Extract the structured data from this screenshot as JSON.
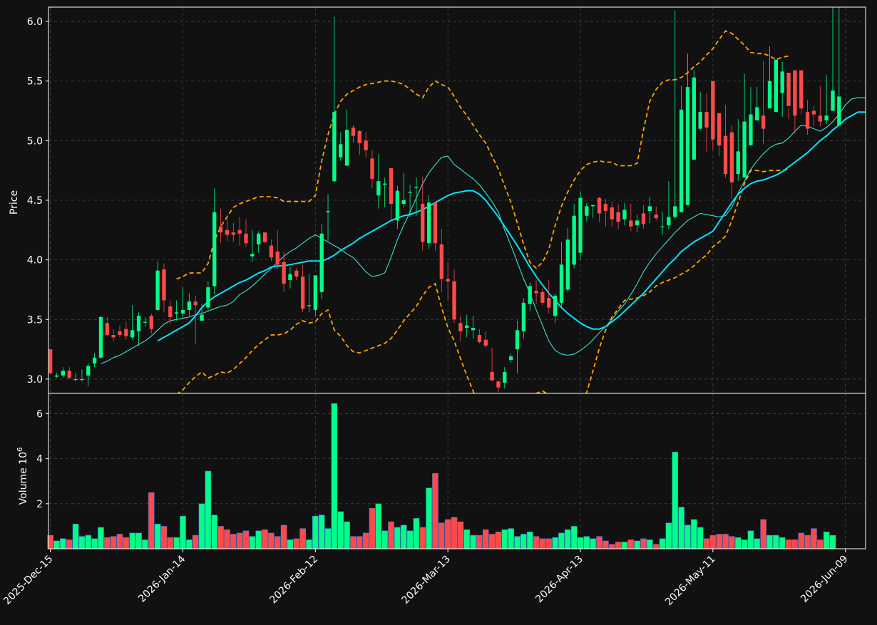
{
  "chart_data": {
    "type": "candlestick",
    "price_panel": {
      "ylabel": "Price",
      "ylim": [
        2.88,
        6.12
      ],
      "yticks": [
        "3.0",
        "3.5",
        "4.0",
        "4.5",
        "5.0",
        "5.5",
        "6.0"
      ],
      "grid": true
    },
    "volume_panel": {
      "ylabel": "Volume  10",
      "ylabel_exponent": "6",
      "ylim": [
        0,
        6.9
      ],
      "yticks": [
        "2",
        "4",
        "6"
      ],
      "grid": true
    },
    "x_tick_labels": [
      {
        "label": "2025-Dec-15",
        "index": 0
      },
      {
        "label": "2026-Jan-14",
        "index": 21
      },
      {
        "label": "2026-Feb-12",
        "index": 42
      },
      {
        "label": "2026-Mar-13",
        "index": 63
      },
      {
        "label": "2026-Apr-13",
        "index": 84
      },
      {
        "label": "2026-May-11",
        "index": 105
      },
      {
        "label": "2026-Jun-09",
        "index": 126
      }
    ],
    "x_range": [
      -0.3,
      129.2
    ],
    "colors": {
      "background": "#111111",
      "up": "#00ff88",
      "down": "#ff4a4a",
      "ma_short": "#40e0d0",
      "ma_long": "#00e5ff",
      "bands": "#ffa500",
      "grid": "#444444"
    },
    "series": [
      {
        "name": "candles",
        "open": [
          3.25,
          3.02,
          3.03,
          3.07,
          3.0,
          3.0,
          3.03,
          3.13,
          3.18,
          3.47,
          3.37,
          3.4,
          3.42,
          3.35,
          3.4,
          3.48,
          3.53,
          3.58,
          3.92,
          3.61,
          3.55,
          3.55,
          3.58,
          3.65,
          3.49,
          3.6,
          3.78,
          4.28,
          4.25,
          4.23,
          4.25,
          4.22,
          4.03,
          4.13,
          4.23,
          4.12,
          4.07,
          3.98,
          3.83,
          3.91,
          3.86,
          3.62,
          3.58,
          3.73,
          4.4,
          4.66,
          4.86,
          4.79,
          5.11,
          5.08,
          5.0,
          4.85,
          4.54,
          4.63,
          4.77,
          4.33,
          4.47,
          4.57,
          4.61,
          4.47,
          4.14,
          4.48,
          4.13,
          3.84,
          3.82,
          3.47,
          3.43,
          3.41,
          3.37,
          3.33,
          3.06,
          2.98,
          2.97,
          3.16,
          3.25,
          3.4,
          3.63,
          3.74,
          3.73,
          3.68,
          3.53,
          3.64,
          3.75,
          3.96,
          4.06,
          4.37,
          4.45,
          4.52,
          4.47,
          4.44,
          4.4,
          4.34,
          4.33,
          4.29,
          4.39,
          4.41,
          4.38,
          4.28,
          4.29,
          4.36,
          4.4,
          4.46,
          4.84,
          5.1,
          5.24,
          5.5,
          5.23,
          5.04,
          5.07,
          4.72,
          4.69,
          4.96,
          5.17,
          5.21,
          5.27,
          5.24,
          5.4,
          5.57,
          5.59,
          5.59,
          5.24,
          5.25,
          5.21,
          5.17,
          5.25,
          5.13,
          5.19,
          5.42
        ],
        "close": [
          3.05,
          3.03,
          3.07,
          3.01,
          3.0,
          3.0,
          3.11,
          3.18,
          3.52,
          3.37,
          3.35,
          3.37,
          3.36,
          3.41,
          3.53,
          3.48,
          3.42,
          3.91,
          3.66,
          3.52,
          3.56,
          3.58,
          3.65,
          3.62,
          3.54,
          3.77,
          4.4,
          4.23,
          4.21,
          4.21,
          4.22,
          4.14,
          4.05,
          4.22,
          4.15,
          4.02,
          3.96,
          3.8,
          3.88,
          3.86,
          3.59,
          3.62,
          3.87,
          4.22,
          4.41,
          5.24,
          4.97,
          5.09,
          5.04,
          4.98,
          4.92,
          4.68,
          4.66,
          4.64,
          4.47,
          4.58,
          4.5,
          4.57,
          4.61,
          4.15,
          4.48,
          4.14,
          3.84,
          3.82,
          3.5,
          3.4,
          3.45,
          3.43,
          3.31,
          3.28,
          2.99,
          2.93,
          3.06,
          3.19,
          3.41,
          3.64,
          3.78,
          3.72,
          3.64,
          3.6,
          3.7,
          3.96,
          4.17,
          4.37,
          4.52,
          4.45,
          4.46,
          4.39,
          4.41,
          4.34,
          4.32,
          4.42,
          4.28,
          4.33,
          4.3,
          4.45,
          4.35,
          4.28,
          4.36,
          4.45,
          5.26,
          5.45,
          5.53,
          5.24,
          5.11,
          5.01,
          4.96,
          4.72,
          4.65,
          4.91,
          5.16,
          5.22,
          5.28,
          5.1,
          5.5,
          5.68,
          5.58,
          5.29,
          5.21,
          5.27,
          5.1,
          5.22,
          5.16,
          5.21,
          5.42,
          5.37
        ],
        "high": [
          3.25,
          3.05,
          3.1,
          3.1,
          3.05,
          3.08,
          3.13,
          3.22,
          3.53,
          3.52,
          3.42,
          3.45,
          3.48,
          3.62,
          3.56,
          3.52,
          3.55,
          3.99,
          3.97,
          3.66,
          3.66,
          3.77,
          3.72,
          3.7,
          3.63,
          3.82,
          4.6,
          4.43,
          4.38,
          4.31,
          4.36,
          4.34,
          4.25,
          4.24,
          4.22,
          4.17,
          4.25,
          4.07,
          3.94,
          3.93,
          3.96,
          3.88,
          3.7,
          4.3,
          4.55,
          6.04,
          5.07,
          5.26,
          5.13,
          5.09,
          5.07,
          4.92,
          4.89,
          4.69,
          4.77,
          4.62,
          4.73,
          4.63,
          4.69,
          4.7,
          4.54,
          4.48,
          4.26,
          3.98,
          3.92,
          3.53,
          3.54,
          3.53,
          3.42,
          3.4,
          3.26,
          2.99,
          3.1,
          3.21,
          3.49,
          3.68,
          3.81,
          3.83,
          3.76,
          3.83,
          3.72,
          4.15,
          4.27,
          4.47,
          4.57,
          4.48,
          4.46,
          4.53,
          4.51,
          4.49,
          4.47,
          4.48,
          4.47,
          4.38,
          4.46,
          4.53,
          4.45,
          4.4,
          4.66,
          6.09,
          5.46,
          5.73,
          5.59,
          5.41,
          5.4,
          5.21,
          5.19,
          5.3,
          5.13,
          5.18,
          5.56,
          5.45,
          5.45,
          5.67,
          5.79,
          5.63,
          5.66,
          5.27,
          5.34,
          5.29,
          5.34,
          5.29,
          5.46,
          5.55
        ],
        "low": [
          3.04,
          3.01,
          3.01,
          3.0,
          2.98,
          2.98,
          2.94,
          3.1,
          3.17,
          3.36,
          3.32,
          3.35,
          3.33,
          3.33,
          3.28,
          3.44,
          3.38,
          3.57,
          3.56,
          3.46,
          3.49,
          3.51,
          3.53,
          3.29,
          3.49,
          3.57,
          3.71,
          4.14,
          4.16,
          4.15,
          4.12,
          4.11,
          3.98,
          4.06,
          4.14,
          3.99,
          3.92,
          3.73,
          3.76,
          3.83,
          3.56,
          3.56,
          3.53,
          3.67,
          4.16,
          4.65,
          4.83,
          4.8,
          4.98,
          4.88,
          4.86,
          4.6,
          4.43,
          4.44,
          4.33,
          4.26,
          4.44,
          4.36,
          4.37,
          4.08,
          4.09,
          4.08,
          3.73,
          3.66,
          3.47,
          3.31,
          3.35,
          3.34,
          3.3,
          3.26,
          2.98,
          2.89,
          2.92,
          3.14,
          3.05,
          3.34,
          3.57,
          3.63,
          3.62,
          3.55,
          3.47,
          3.6,
          3.73,
          3.93,
          4.0,
          4.32,
          4.35,
          4.32,
          4.28,
          4.28,
          4.26,
          4.29,
          4.24,
          4.23,
          4.26,
          4.31,
          4.33,
          4.21,
          4.26,
          4.34,
          4.83,
          5.0,
          5.09,
          5.08,
          4.91,
          4.92,
          4.87,
          4.69,
          4.51,
          4.66,
          4.9,
          5.14,
          5.19,
          4.97,
          5.3,
          5.48,
          5.2,
          5.18,
          5.06,
          5.22,
          5.05,
          5.12,
          5.12,
          5.14,
          5.31,
          5.22
        ]
      },
      {
        "name": "volume",
        "values": [
          0.6,
          0.35,
          0.45,
          0.4,
          1.1,
          0.55,
          0.6,
          0.45,
          0.95,
          0.5,
          0.55,
          0.65,
          0.5,
          0.7,
          0.7,
          0.4,
          2.5,
          1.1,
          1.0,
          0.5,
          0.5,
          1.45,
          0.4,
          0.6,
          2.0,
          3.45,
          1.5,
          1.0,
          0.85,
          0.65,
          0.7,
          0.8,
          0.55,
          0.8,
          0.85,
          0.7,
          0.55,
          1.05,
          0.4,
          0.45,
          0.9,
          0.4,
          1.45,
          1.5,
          0.9,
          6.45,
          1.65,
          1.2,
          0.55,
          0.55,
          0.7,
          1.8,
          2.0,
          0.8,
          1.2,
          0.95,
          1.05,
          0.8,
          1.35,
          0.95,
          2.7,
          3.35,
          1.15,
          1.3,
          1.4,
          1.2,
          0.85,
          0.6,
          0.6,
          0.85,
          0.65,
          0.75,
          0.85,
          0.9,
          0.55,
          0.65,
          0.75,
          0.55,
          0.45,
          0.45,
          0.5,
          0.7,
          0.85,
          1.0,
          0.5,
          0.55,
          0.45,
          0.55,
          0.35,
          0.2,
          0.3,
          0.3,
          0.4,
          0.35,
          0.45,
          0.4,
          0.2,
          0.45,
          1.15,
          4.3,
          1.85,
          1.05,
          1.3,
          0.95,
          0.45,
          0.6,
          0.65,
          0.65,
          0.55,
          0.5,
          0.4,
          0.8,
          0.45,
          1.3,
          0.6,
          0.6,
          0.5,
          0.4,
          0.4,
          0.7,
          0.6,
          0.9,
          0.4,
          0.75,
          0.6
        ]
      },
      {
        "name": "ma_short",
        "start": 8,
        "values": [
          3.13,
          3.15,
          3.18,
          3.2,
          3.23,
          3.26,
          3.29,
          3.32,
          3.36,
          3.41,
          3.46,
          3.49,
          3.5,
          3.51,
          3.52,
          3.54,
          3.55,
          3.57,
          3.59,
          3.61,
          3.62,
          3.65,
          3.71,
          3.74,
          3.78,
          3.83,
          3.88,
          3.93,
          3.98,
          4.03,
          4.07,
          4.1,
          4.14,
          4.18,
          4.21,
          4.18,
          4.15,
          4.12,
          4.09,
          4.05,
          4.02,
          3.96,
          3.9,
          3.86,
          3.87,
          3.89,
          4.02,
          4.17,
          4.29,
          4.4,
          4.52,
          4.64,
          4.73,
          4.8,
          4.86,
          4.87,
          4.8,
          4.76,
          4.72,
          4.68,
          4.63,
          4.56,
          4.49,
          4.4,
          4.25,
          4.12,
          3.98,
          3.84,
          3.72,
          3.58,
          3.45,
          3.32,
          3.24,
          3.21,
          3.2,
          3.21,
          3.24,
          3.28,
          3.33,
          3.39,
          3.44,
          3.5,
          3.57,
          3.63,
          3.71,
          3.8,
          3.9,
          3.98,
          4.05,
          4.11,
          4.17,
          4.23,
          4.28,
          4.33,
          4.36,
          4.39,
          4.38,
          4.37,
          4.36,
          4.37,
          4.44,
          4.56,
          4.66,
          4.76,
          4.83,
          4.89,
          4.94,
          4.97,
          4.98,
          5.02,
          5.08,
          5.13,
          5.12,
          5.1,
          5.08,
          5.11,
          5.16,
          5.22,
          5.3,
          5.35,
          5.36,
          5.36,
          5.35,
          5.35,
          5.34,
          5.3
        ]
      },
      {
        "name": "ma_long",
        "start": 17,
        "values": [
          3.32,
          3.35,
          3.38,
          3.41,
          3.44,
          3.47,
          3.53,
          3.6,
          3.65,
          3.69,
          3.72,
          3.75,
          3.78,
          3.81,
          3.83,
          3.86,
          3.89,
          3.91,
          3.94,
          3.95,
          3.95,
          3.96,
          3.97,
          3.98,
          3.99,
          3.99,
          3.99,
          4.01,
          4.04,
          4.08,
          4.11,
          4.14,
          4.18,
          4.21,
          4.24,
          4.27,
          4.3,
          4.33,
          4.35,
          4.37,
          4.38,
          4.4,
          4.42,
          4.45,
          4.48,
          4.51,
          4.54,
          4.56,
          4.57,
          4.58,
          4.58,
          4.55,
          4.5,
          4.43,
          4.36,
          4.28,
          4.2,
          4.12,
          4.03,
          3.94,
          3.86,
          3.79,
          3.72,
          3.66,
          3.6,
          3.55,
          3.51,
          3.47,
          3.44,
          3.42,
          3.42,
          3.44,
          3.48,
          3.52,
          3.57,
          3.62,
          3.67,
          3.72,
          3.78,
          3.84,
          3.9,
          3.96,
          4.01,
          4.07,
          4.11,
          4.15,
          4.18,
          4.21,
          4.24,
          4.32,
          4.4,
          4.48,
          4.55,
          4.6,
          4.64,
          4.66,
          4.67,
          4.69,
          4.71,
          4.74,
          4.78,
          4.82,
          4.86,
          4.9,
          4.95,
          5.0,
          5.04,
          5.09,
          5.13,
          5.18,
          5.21,
          5.24,
          5.24,
          5.23,
          5.21,
          5.2,
          5.2,
          5.22,
          5.23
        ]
      },
      {
        "name": "upper_band",
        "start": 20,
        "values": [
          3.84,
          3.86,
          3.89,
          3.89,
          3.89,
          3.97,
          4.16,
          4.28,
          4.36,
          4.44,
          4.47,
          4.49,
          4.51,
          4.53,
          4.53,
          4.53,
          4.52,
          4.49,
          4.49,
          4.49,
          4.49,
          4.49,
          4.54,
          4.83,
          5.05,
          5.22,
          5.33,
          5.39,
          5.42,
          5.45,
          5.47,
          5.48,
          5.49,
          5.5,
          5.5,
          5.49,
          5.47,
          5.43,
          5.39,
          5.36,
          5.45,
          5.5,
          5.47,
          5.45,
          5.37,
          5.28,
          5.21,
          5.13,
          5.05,
          4.98,
          4.87,
          4.76,
          4.62,
          4.48,
          4.31,
          4.13,
          3.98,
          3.93,
          3.98,
          4.09,
          4.29,
          4.45,
          4.57,
          4.67,
          4.75,
          4.8,
          4.82,
          4.83,
          4.82,
          4.82,
          4.79,
          4.79,
          4.79,
          4.81,
          5.09,
          5.33,
          5.43,
          5.49,
          5.51,
          5.51,
          5.53,
          5.57,
          5.62,
          5.66,
          5.72,
          5.77,
          5.85,
          5.92,
          5.9,
          5.85,
          5.8,
          5.74,
          5.73,
          5.73,
          5.71,
          5.68,
          5.7,
          5.71
        ]
      },
      {
        "name": "lower_band",
        "start": 20,
        "values": [
          2.87,
          2.91,
          2.97,
          3.02,
          3.06,
          3.01,
          3.03,
          3.06,
          3.05,
          3.08,
          3.13,
          3.18,
          3.24,
          3.29,
          3.33,
          3.37,
          3.37,
          3.38,
          3.41,
          3.46,
          3.49,
          3.47,
          3.48,
          3.55,
          3.58,
          3.41,
          3.36,
          3.28,
          3.23,
          3.22,
          3.24,
          3.26,
          3.28,
          3.3,
          3.34,
          3.41,
          3.49,
          3.55,
          3.61,
          3.7,
          3.77,
          3.8,
          3.6,
          3.43,
          3.32,
          3.17,
          3.03,
          2.9,
          2.74,
          2.62,
          2.55,
          2.5,
          2.48,
          2.52,
          2.57,
          2.63,
          2.74,
          2.88,
          2.9,
          2.87,
          2.8,
          2.73,
          2.7,
          2.72,
          2.79,
          2.89,
          3.07,
          3.26,
          3.41,
          3.52,
          3.59,
          3.66,
          3.67,
          3.68,
          3.7,
          3.73,
          3.78,
          3.81,
          3.83,
          3.85,
          3.88,
          3.91,
          3.95,
          4.0,
          4.04,
          4.11,
          4.15,
          4.2,
          4.33,
          4.48,
          4.64,
          4.75,
          4.75,
          4.74,
          4.75,
          4.75,
          4.75,
          4.76
        ]
      }
    ]
  }
}
